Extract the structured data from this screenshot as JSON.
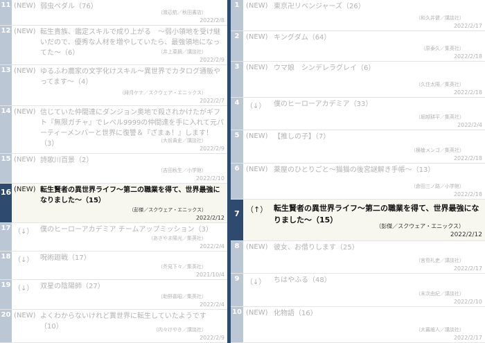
{
  "left": [
    {
      "rank": "11",
      "status": "(NEW)",
      "title": "弱虫ペダル（76）",
      "author": "（渡辺航／秋田書店）",
      "date": "2022/2/8"
    },
    {
      "rank": "12",
      "status": "(NEW)",
      "title": "転生貴族、鑑定スキルで成り上がる　～弱小領地を受け継いだので、優秀な人材を増やしていたら、最強領地になってた～（6）",
      "author": "（井上菜摘／講談社）",
      "date": "2022/2/9"
    },
    {
      "rank": "13",
      "status": "(NEW)",
      "title": "ゆるふわ農家の文字化けスキル～異世界でカタログ通販やってます～（4）",
      "author": "（緋月ケナ／スクウェア・エニックス）",
      "date": "2022/2/7"
    },
    {
      "rank": "14",
      "status": "(NEW)",
      "title": "信じていた仲間達にダンジョン奥地で殺されかけたがギフト『無限ガチャ』でレベル9999の仲間達を手に入れて元パーティーメンバーと世界に復讐＆『ざまぁ！』します！（3）",
      "author": "（大前貴史／講談社）",
      "date": "2022/2/9"
    },
    {
      "rank": "15",
      "status": "(NEW)",
      "title": "詩歌川百景（2）",
      "author": "（吉田秋生／小学館）",
      "date": "2022/2/10"
    },
    {
      "rank": "16",
      "status": "(NEW)",
      "title": "転生賢者の異世界ライフ～第二の職業を得て、世界最強になりました～（15）",
      "author": "（彭傑／スクウェア・エニックス）",
      "date": "2022/2/12",
      "highlight": true
    },
    {
      "rank": "17",
      "status": "（↓）",
      "title": "僕のヒーローアカデミア チームアップミッション（3）",
      "author": "（あきやま陽光／集英社）",
      "date": "2022/2/4"
    },
    {
      "rank": "18",
      "status": "（↓）",
      "title": "呪術廻戦（17）",
      "author": "（芥見下々／集英社）",
      "date": "2021/10/4"
    },
    {
      "rank": "19",
      "status": "（↓）",
      "title": "双星の陰陽師（27）",
      "author": "（助野嘉昭／集英社）",
      "date": "2022/2/4"
    },
    {
      "rank": "20",
      "status": "(NEW)",
      "title": "よくわからないけれど異世界に転生していたようです（10）",
      "author": "（内々けやき／講談社）",
      "date": "2022/2/9"
    }
  ],
  "right": [
    {
      "rank": "1",
      "status": "(NEW)",
      "title": "東京卍リベンジャーズ（26）",
      "author": "（和久井健／講談社）",
      "date": "2022/2/17"
    },
    {
      "rank": "2",
      "status": "(NEW)",
      "title": "キングダム（64）",
      "author": "（原泰久／集英社）",
      "date": "2022/2/18"
    },
    {
      "rank": "3",
      "status": "(NEW)",
      "title": "ウマ娘　シンデレラグレイ（6）",
      "author": "（久住太陽／集英社）",
      "date": "2022/2/18"
    },
    {
      "rank": "4",
      "status": "（↓）",
      "title": "僕のヒーローアカデミア（33）",
      "author": "（堀越耕平／集英社）",
      "date": "2022/2/4"
    },
    {
      "rank": "5",
      "status": "(NEW)",
      "title": "【推しの子】（7）",
      "author": "（横槍メンゴ／集英社）",
      "date": "2022/2/18"
    },
    {
      "rank": "6",
      "status": "(NEW)",
      "title": "薬屋のひとりごと～猫猫の後宮謎解き手帳～（13）",
      "author": "（倉田三ノ路／小学館）",
      "date": "2022/2/18"
    },
    {
      "rank": "7",
      "status": "（↑）",
      "title": "転生賢者の異世界ライフ～第二の職業を得て、世界最強になりました～（15）",
      "author": "（彭傑／スクウェア・エニックス）",
      "date": "2022/2/12",
      "highlight": true
    },
    {
      "rank": "8",
      "status": "(NEW)",
      "title": "彼女、お借りします（25）",
      "author": "（宮島礼吏／講談社）",
      "date": "2022/2/17"
    },
    {
      "rank": "9",
      "status": "（↓）",
      "title": "ちはやふる（48）",
      "author": "（末次由紀／講談社）",
      "date": "2022/2/10"
    },
    {
      "rank": "10",
      "status": "(NEW)",
      "title": "化物語（16）",
      "author": "（大暮維人／講談社）",
      "date": "2022/2/17"
    }
  ]
}
